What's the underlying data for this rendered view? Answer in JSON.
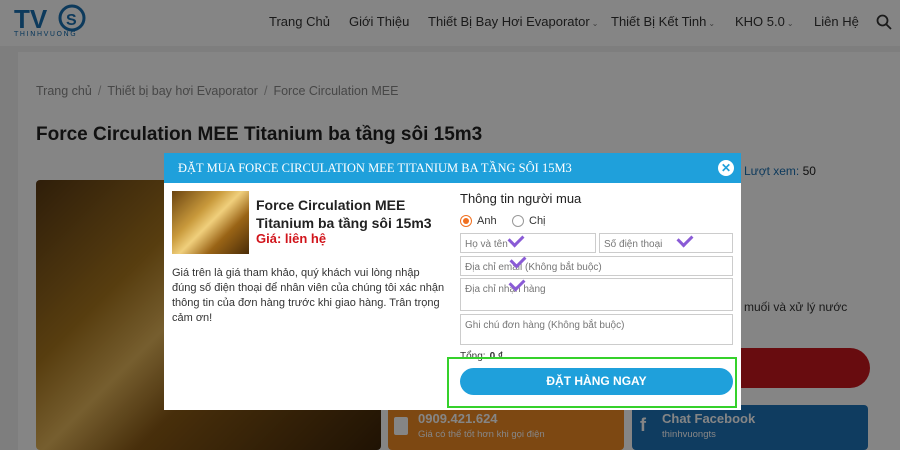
{
  "header": {
    "logo_text": "THINHVUONG",
    "nav": [
      {
        "label": "Trang Chủ",
        "has_dropdown": false
      },
      {
        "label": "Giới Thiệu",
        "has_dropdown": false
      },
      {
        "label": "Thiết Bị Bay Hơi Evaporator",
        "has_dropdown": true
      },
      {
        "label": "Thiết Bị Kết Tinh",
        "has_dropdown": true
      },
      {
        "label": "KHO 5.0",
        "has_dropdown": true
      },
      {
        "label": "Liên Hệ",
        "has_dropdown": false
      }
    ],
    "search_icon": "search-icon"
  },
  "page": {
    "breadcrumb": [
      "Trang chủ",
      "Thiết bị bay hơi Evaporator",
      "Force Circulation MEE"
    ],
    "title": "Force Circulation MEE Titanium ba tầng sôi 15m3",
    "views_label": "Lượt xem:",
    "views_count": "50",
    "side_text": "muối và xử lý nước",
    "phone": {
      "number": "0909.421.624",
      "sub": "Giá có thể tốt hơn khi gọi điện"
    },
    "facebook": {
      "label": "Chat Facebook",
      "sub": "thinhvuongts"
    }
  },
  "modal": {
    "title": "ĐẶT MUA FORCE CIRCULATION MEE TITANIUM BA TẦNG SÔI 15M3",
    "close_icon": "close-icon",
    "product_name": "Force Circulation MEE Titanium ba tầng sôi 15m3",
    "price": "Giá: liên hệ",
    "note": "Giá trên là giá tham khảo, quý khách vui lòng nhập đúng số điện thoại để nhân viên của chúng tôi xác nhận thông tin của đơn hàng trước khi giao hàng. Trân trọng cảm ơn!",
    "buyer_title": "Thông tin người mua",
    "gender_options": [
      {
        "label": "Anh",
        "selected": true
      },
      {
        "label": "Chị",
        "selected": false
      }
    ],
    "fields": {
      "name": {
        "placeholder": "Họ và tên",
        "value": ""
      },
      "phone": {
        "placeholder": "Số điện thoại",
        "value": ""
      },
      "email": {
        "placeholder": "Địa chỉ email (Không bắt buộc)",
        "value": ""
      },
      "address": {
        "placeholder": "Địa chỉ nhận hàng",
        "value": ""
      },
      "note": {
        "placeholder": "Ghi chú đơn hàng (Không bắt buộc)",
        "value": ""
      }
    },
    "total_label": "Tổng:",
    "total_value": "0 ₫",
    "order_button": "ĐẶT HÀNG NGAY"
  },
  "colors": {
    "accent": "#1fa0db",
    "price_red": "#d1141b",
    "radio_orange": "#f07020",
    "highlight_green": "#35d12b",
    "checkmark_purple": "#8a5bd6"
  }
}
